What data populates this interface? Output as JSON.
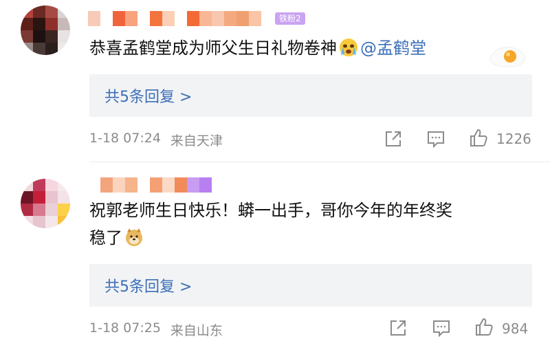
{
  "comments": [
    {
      "user_tag": "铁粉2",
      "text": "恭喜孟鹤堂成为师父生日礼物卷神",
      "mention": "@孟鹤堂",
      "emoji": "crying-face-emoji",
      "replies": "共5条回复 >",
      "time": "1-18 07:24",
      "location": "来自天津",
      "likes": "1226"
    },
    {
      "text_line1": "祝郭老师生日快乐！蟒一出手，哥你今年的年终奖",
      "text_line2": "稳了",
      "emoji": "doge-emoji",
      "replies": "共5条回复 >",
      "time": "1-18 07:25",
      "location": "来自山东",
      "likes": "984"
    }
  ],
  "colors": {
    "link": "#3b6fb8",
    "meta": "#8b8b8b",
    "reply_bg": "#f2f3f5"
  }
}
